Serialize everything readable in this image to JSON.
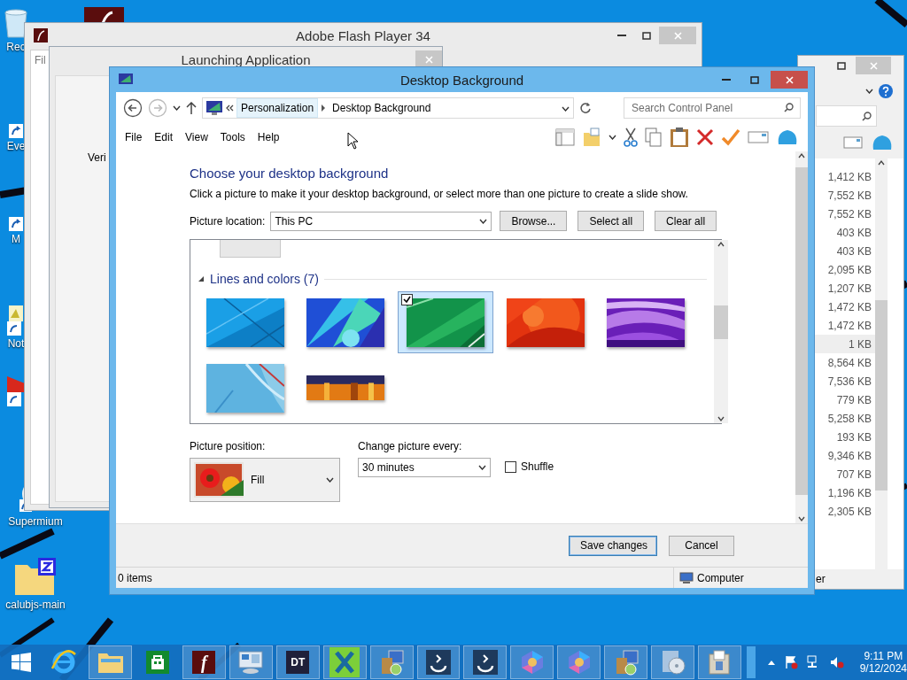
{
  "desktop_icons": [
    {
      "kind": "recycle",
      "label": "Rec"
    },
    {
      "kind": "shortcut",
      "label": "Eve"
    },
    {
      "kind": "shortcut",
      "label": "M"
    },
    {
      "kind": "note",
      "label": "Not"
    },
    {
      "kind": "media"
    },
    {
      "kind": "globe",
      "label": "Supermium"
    },
    {
      "kind": "zip",
      "label": "calubjs-main"
    }
  ],
  "flash_window": {
    "title": "Adobe Flash Player 34",
    "menu": "Fil",
    "dialog": {
      "title": "Launching Application",
      "text": "Veri"
    }
  },
  "explorer_window": {
    "sizes": [
      {
        "text": "1,412 KB",
        "selected": false
      },
      {
        "text": "7,552 KB",
        "selected": false
      },
      {
        "text": "7,552 KB",
        "selected": false
      },
      {
        "text": "403 KB",
        "selected": false
      },
      {
        "text": "403 KB",
        "selected": false
      },
      {
        "text": "2,095 KB",
        "selected": false
      },
      {
        "text": "1,207 KB",
        "selected": false
      },
      {
        "text": "1,472 KB",
        "selected": false
      },
      {
        "text": "1,472 KB",
        "selected": false
      },
      {
        "text": "1 KB",
        "selected": true
      },
      {
        "text": "8,564 KB",
        "selected": false
      },
      {
        "text": "7,536 KB",
        "selected": false
      },
      {
        "text": "779 KB",
        "selected": false
      },
      {
        "text": "5,258 KB",
        "selected": false
      },
      {
        "text": "193 KB",
        "selected": false
      },
      {
        "text": "9,346 KB",
        "selected": false
      },
      {
        "text": "707 KB",
        "selected": false
      },
      {
        "text": "1,196 KB",
        "selected": false
      },
      {
        "text": "2,305 KB",
        "selected": false
      }
    ],
    "status": "er"
  },
  "dialog": {
    "title": "Desktop Background",
    "breadcrumb": [
      "Personalization",
      "Desktop Background"
    ],
    "search": {
      "placeholder": "Search Control Panel"
    },
    "menu": [
      "File",
      "Edit",
      "View",
      "Tools",
      "Help"
    ],
    "heading": "Choose your desktop background",
    "description": "Click a picture to make it your desktop background, or select more than one picture to create a slide show.",
    "picture_location": {
      "label": "Picture location:",
      "value": "This PC"
    },
    "buttons": [
      "Browse...",
      "Select all",
      "Clear all"
    ],
    "group": {
      "title": "Lines and colors (7)",
      "expanded": true
    },
    "thumbnails": [
      {
        "selected": false,
        "checked": false
      },
      {
        "selected": false,
        "checked": false
      },
      {
        "selected": true,
        "checked": true
      },
      {
        "selected": false,
        "checked": false
      },
      {
        "selected": false,
        "checked": false
      },
      {
        "selected": false,
        "checked": false
      },
      {
        "selected": false,
        "checked": false
      }
    ],
    "picture_position": {
      "label": "Picture position:",
      "value": "Fill"
    },
    "change_every": {
      "label": "Change picture every:",
      "value": "30 minutes"
    },
    "shuffle": {
      "label": "Shuffle",
      "checked": false
    },
    "footer_buttons": [
      {
        "label": "Save changes",
        "default": true
      },
      {
        "label": "Cancel",
        "default": false
      }
    ],
    "status": {
      "items": "0 items",
      "zone": "Computer"
    }
  },
  "taskbar": {
    "apps": [
      {
        "kind": "browser",
        "running": false
      },
      {
        "kind": "folder",
        "running": true
      },
      {
        "kind": "store",
        "running": false
      },
      {
        "kind": "letter",
        "label": "f",
        "running": true
      },
      {
        "kind": "panel",
        "running": true
      },
      {
        "kind": "letter",
        "label": "DT",
        "running": true
      },
      {
        "kind": "cross",
        "running": true
      },
      {
        "kind": "setup",
        "running": true
      },
      {
        "kind": "disc",
        "running": true
      },
      {
        "kind": "disc",
        "running": true
      },
      {
        "kind": "ring",
        "running": true
      },
      {
        "kind": "ring",
        "running": true
      },
      {
        "kind": "setup",
        "running": true
      },
      {
        "kind": "cd",
        "running": true
      },
      {
        "kind": "box",
        "running": true
      }
    ],
    "clock": {
      "time": "9:11 PM",
      "date": "9/12/2024"
    }
  }
}
